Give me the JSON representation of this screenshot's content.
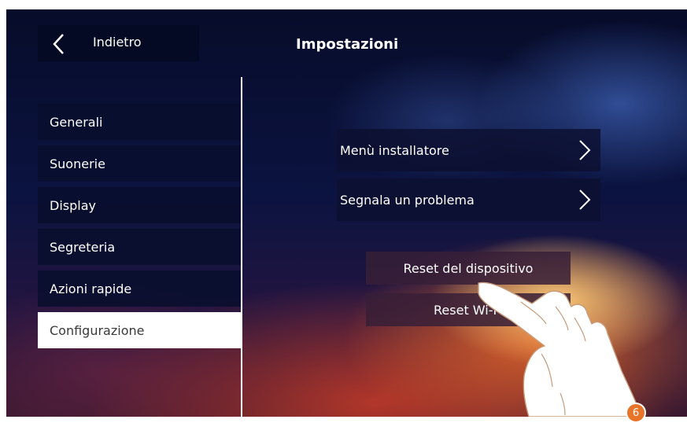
{
  "header": {
    "back_label": "Indietro",
    "title": "Impostazioni"
  },
  "sidebar": {
    "items": [
      {
        "label": "Generali",
        "active": false
      },
      {
        "label": "Suonerie",
        "active": false
      },
      {
        "label": "Display",
        "active": false
      },
      {
        "label": "Segreteria",
        "active": false
      },
      {
        "label": "Azioni rapide",
        "active": false
      },
      {
        "label": "Configurazione",
        "active": true
      }
    ]
  },
  "main": {
    "options": [
      {
        "label": "Menù installatore",
        "icon": "chevron-right-icon"
      },
      {
        "label": "Segnala un problema",
        "icon": "chevron-right-icon"
      }
    ],
    "reset_device_label": "Reset del dispositivo",
    "reset_wifi_label": "Reset Wi-Fi"
  },
  "overlay": {
    "step_badge": "6",
    "hand_icon": "pointing-hand-icon"
  },
  "colors": {
    "badge": "#e8742a",
    "active_item_bg": "#ffffff",
    "panel_bg": "#0a1035"
  }
}
